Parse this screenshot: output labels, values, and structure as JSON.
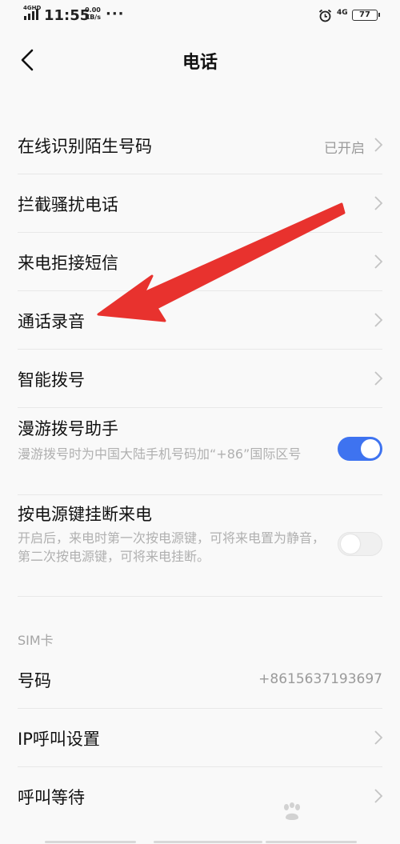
{
  "status_bar": {
    "network_label": "4GHD",
    "time": "11:55",
    "speed_value": "0.00",
    "speed_unit": "KB/s",
    "more": "···",
    "sim_network": "4G",
    "battery_level": "77"
  },
  "header": {
    "title": "电话"
  },
  "rows": [
    {
      "label": "在线识别陌生号码",
      "value": "已开启"
    },
    {
      "label": "拦截骚扰电话"
    },
    {
      "label": "来电拒接短信"
    },
    {
      "label": "通话录音"
    },
    {
      "label": "智能拨号"
    }
  ],
  "toggles": [
    {
      "label": "漫游拨号助手",
      "description": "漫游拨号时为中国大陆手机号码加“+86”国际区号",
      "enabled": true
    },
    {
      "label": "按电源键挂断来电",
      "description": "开启后，来电时第一次按电源键，可将来电置为静音，第二次按电源键，可将来电挂断。",
      "enabled": false
    }
  ],
  "sim_section": {
    "header": "SIM卡",
    "number_label": "号码",
    "number_value": "+8615637193697",
    "ip_call_label": "IP呼叫设置",
    "call_waiting_label": "呼叫等待"
  },
  "colors": {
    "accent": "#3e73f0",
    "annotation": "#e8322e"
  },
  "watermark": "Bai 经验"
}
